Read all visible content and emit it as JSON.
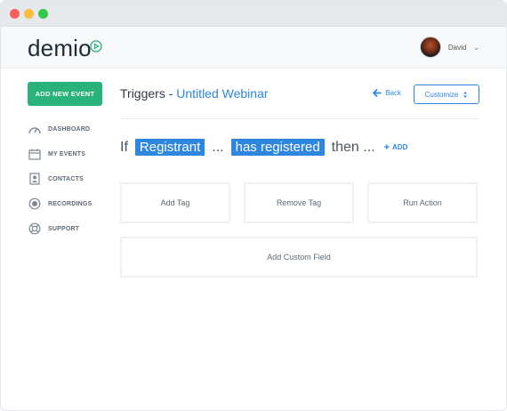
{
  "app": {
    "logo_text": "demio",
    "user_name": "David"
  },
  "sidebar": {
    "new_event_label": "ADD NEW EVENT",
    "items": [
      {
        "label": "DASHBOARD",
        "icon": "gauge-icon"
      },
      {
        "label": "MY EVENTS",
        "icon": "calendar-icon"
      },
      {
        "label": "CONTACTS",
        "icon": "contact-book-icon"
      },
      {
        "label": "RECORDINGS",
        "icon": "record-icon"
      },
      {
        "label": "SUPPORT",
        "icon": "lifebuoy-icon"
      }
    ]
  },
  "header": {
    "prefix": "Triggers - ",
    "webinar": "Untitled Webinar",
    "back_label": "Back",
    "customize_label": "Customize"
  },
  "rule": {
    "if": "If",
    "subject": "Registrant",
    "ellipsis1": "...",
    "condition": "has registered",
    "then": "then ...",
    "add_label": "ADD",
    "add_symbol": "+"
  },
  "actions": {
    "add_tag": "Add Tag",
    "remove_tag": "Remove Tag",
    "run_action": "Run Action",
    "add_custom_field": "Add Custom Field"
  },
  "colors": {
    "accent_blue": "#2e86de",
    "brand_green": "#2ab27b",
    "text_dark": "#2e3a46"
  }
}
